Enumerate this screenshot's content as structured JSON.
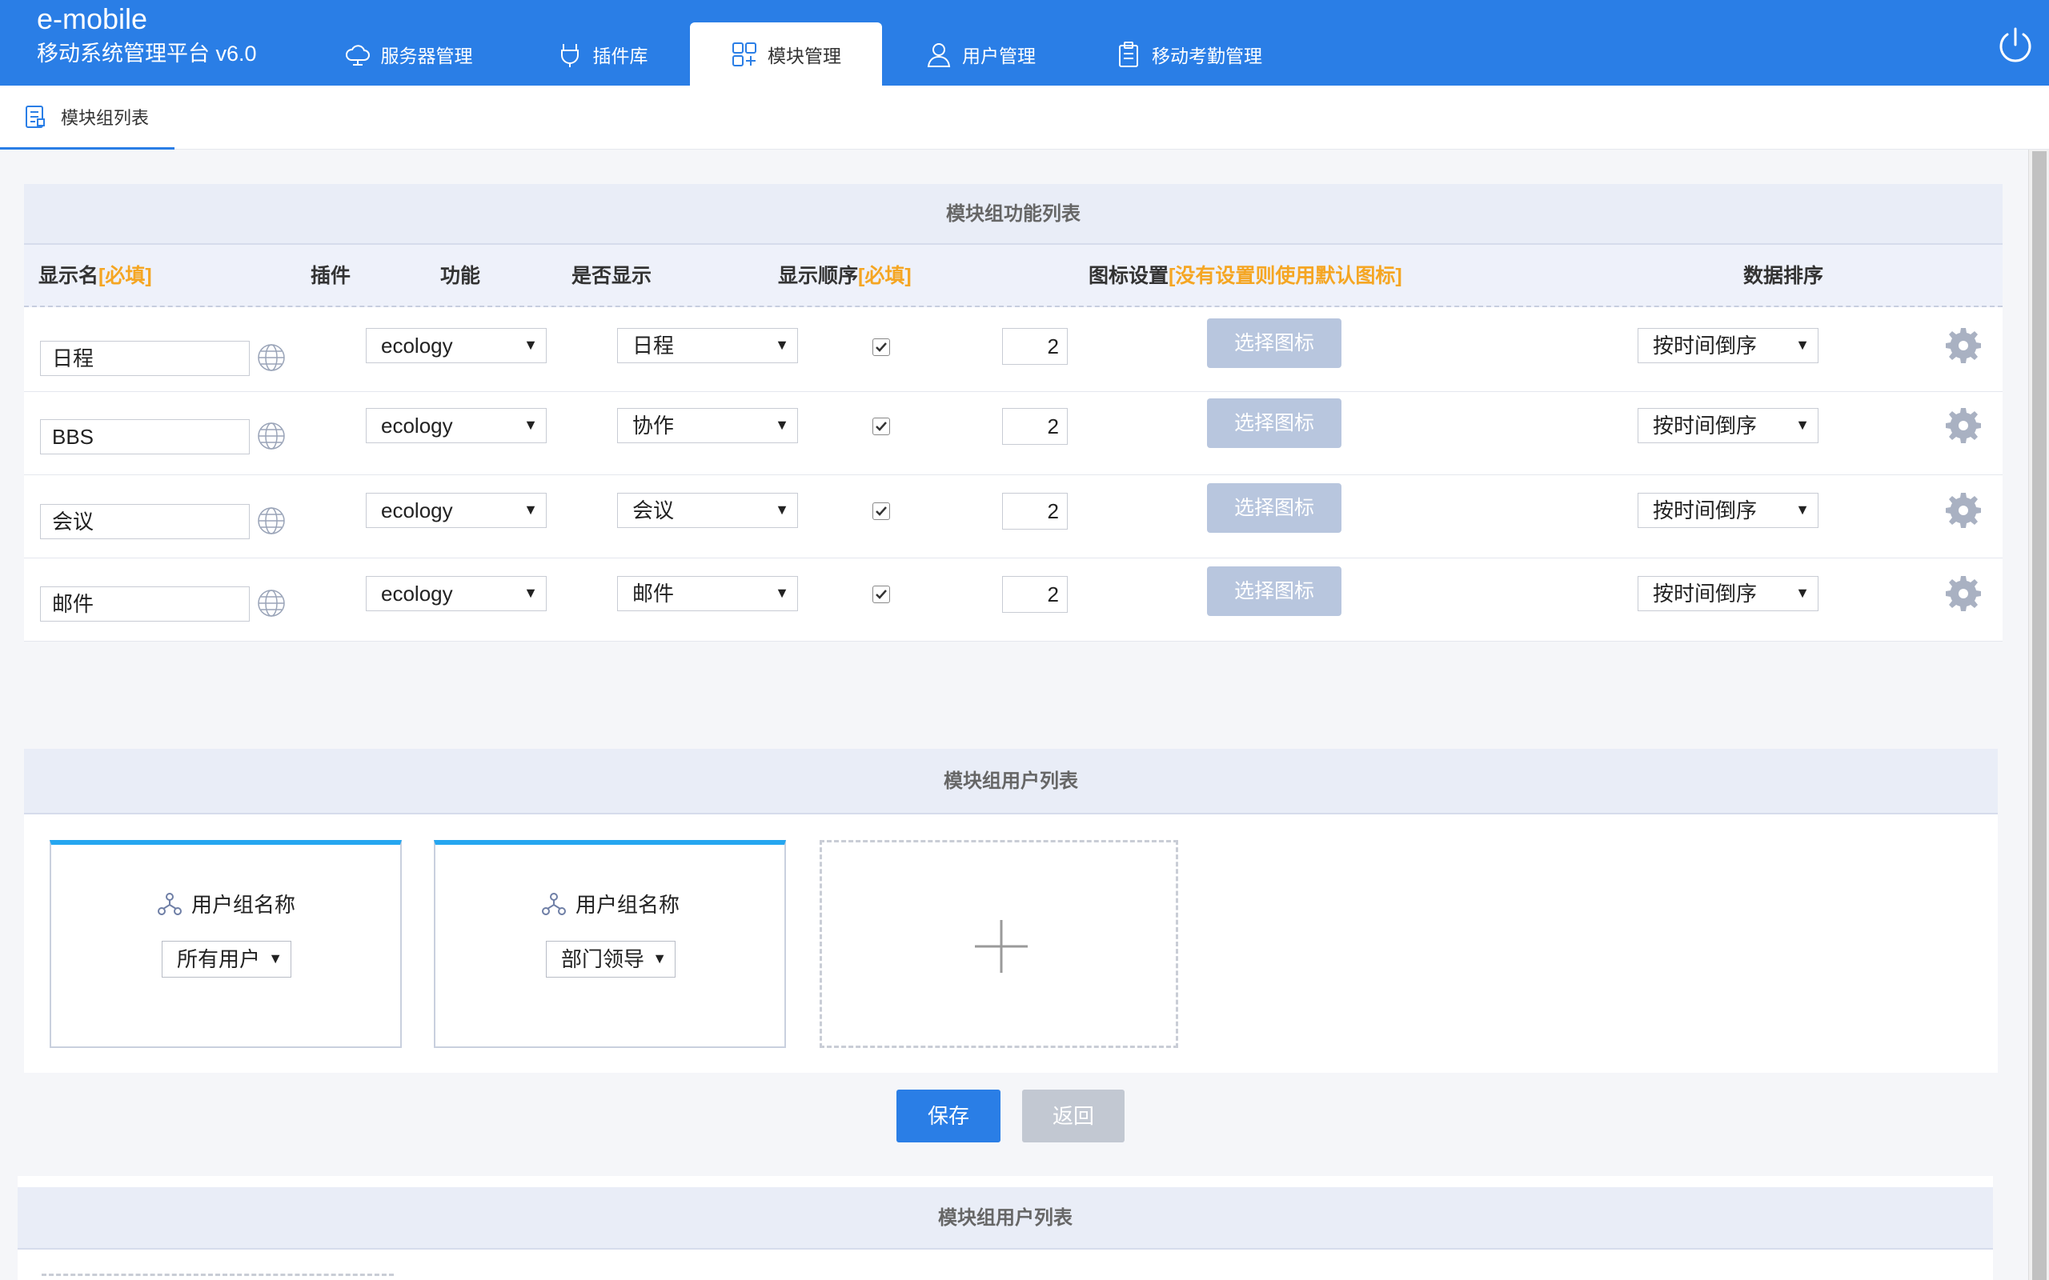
{
  "header": {
    "brand_name": "e-mobile",
    "brand_subtitle": "移动系统管理平台 v6.0",
    "tabs": [
      {
        "label": "服务器管理",
        "icon": "cloud-icon",
        "active": false
      },
      {
        "label": "插件库",
        "icon": "plug-icon",
        "active": false
      },
      {
        "label": "模块管理",
        "icon": "modules-icon",
        "active": true
      },
      {
        "label": "用户管理",
        "icon": "user-icon",
        "active": false
      },
      {
        "label": "移动考勤管理",
        "icon": "clipboard-icon",
        "active": false
      }
    ],
    "power_icon": "power-icon"
  },
  "subtabs": [
    {
      "label": "模块组列表",
      "icon": "document-list-icon",
      "active": true
    }
  ],
  "function_list": {
    "title": "模块组功能列表",
    "columns": {
      "display_name": "显示名",
      "display_name_required": "[必填]",
      "plugin": "插件",
      "function": "功能",
      "visible": "是否显示",
      "order": "显示顺序",
      "order_required": "[必填]",
      "icon_settings": "图标设置",
      "icon_settings_note": "[没有设置则使用默认图标]",
      "data_sort": "数据排序"
    },
    "rows": [
      {
        "name": "日程",
        "plugin": "ecology",
        "function": "日程",
        "visible": true,
        "order": "2",
        "icon_button": "选择图标",
        "sort": "按时间倒序"
      },
      {
        "name": "BBS",
        "plugin": "ecology",
        "function": "协作",
        "visible": true,
        "order": "2",
        "icon_button": "选择图标",
        "sort": "按时间倒序"
      },
      {
        "name": "会议",
        "plugin": "ecology",
        "function": "会议",
        "visible": true,
        "order": "2",
        "icon_button": "选择图标",
        "sort": "按时间倒序"
      },
      {
        "name": "邮件",
        "plugin": "ecology",
        "function": "邮件",
        "visible": true,
        "order": "2",
        "icon_button": "选择图标",
        "sort": "按时间倒序"
      }
    ]
  },
  "user_list": {
    "title": "模块组用户列表",
    "cards": [
      {
        "label": "用户组名称",
        "selected": "所有用户"
      },
      {
        "label": "用户组名称",
        "selected": "部门领导"
      }
    ],
    "add_icon": "plus-icon"
  },
  "buttons": {
    "save": "保存",
    "back": "返回"
  },
  "user_list_2": {
    "title": "模块组用户列表"
  },
  "colors": {
    "header_bg": "#2a7ee6",
    "accent_required": "#f5a623",
    "card_top_border": "#25a6f0",
    "icon_button_bg": "#b8c6de",
    "save_button_bg": "#2a7ee6",
    "back_button_bg": "#c2c8d2"
  }
}
